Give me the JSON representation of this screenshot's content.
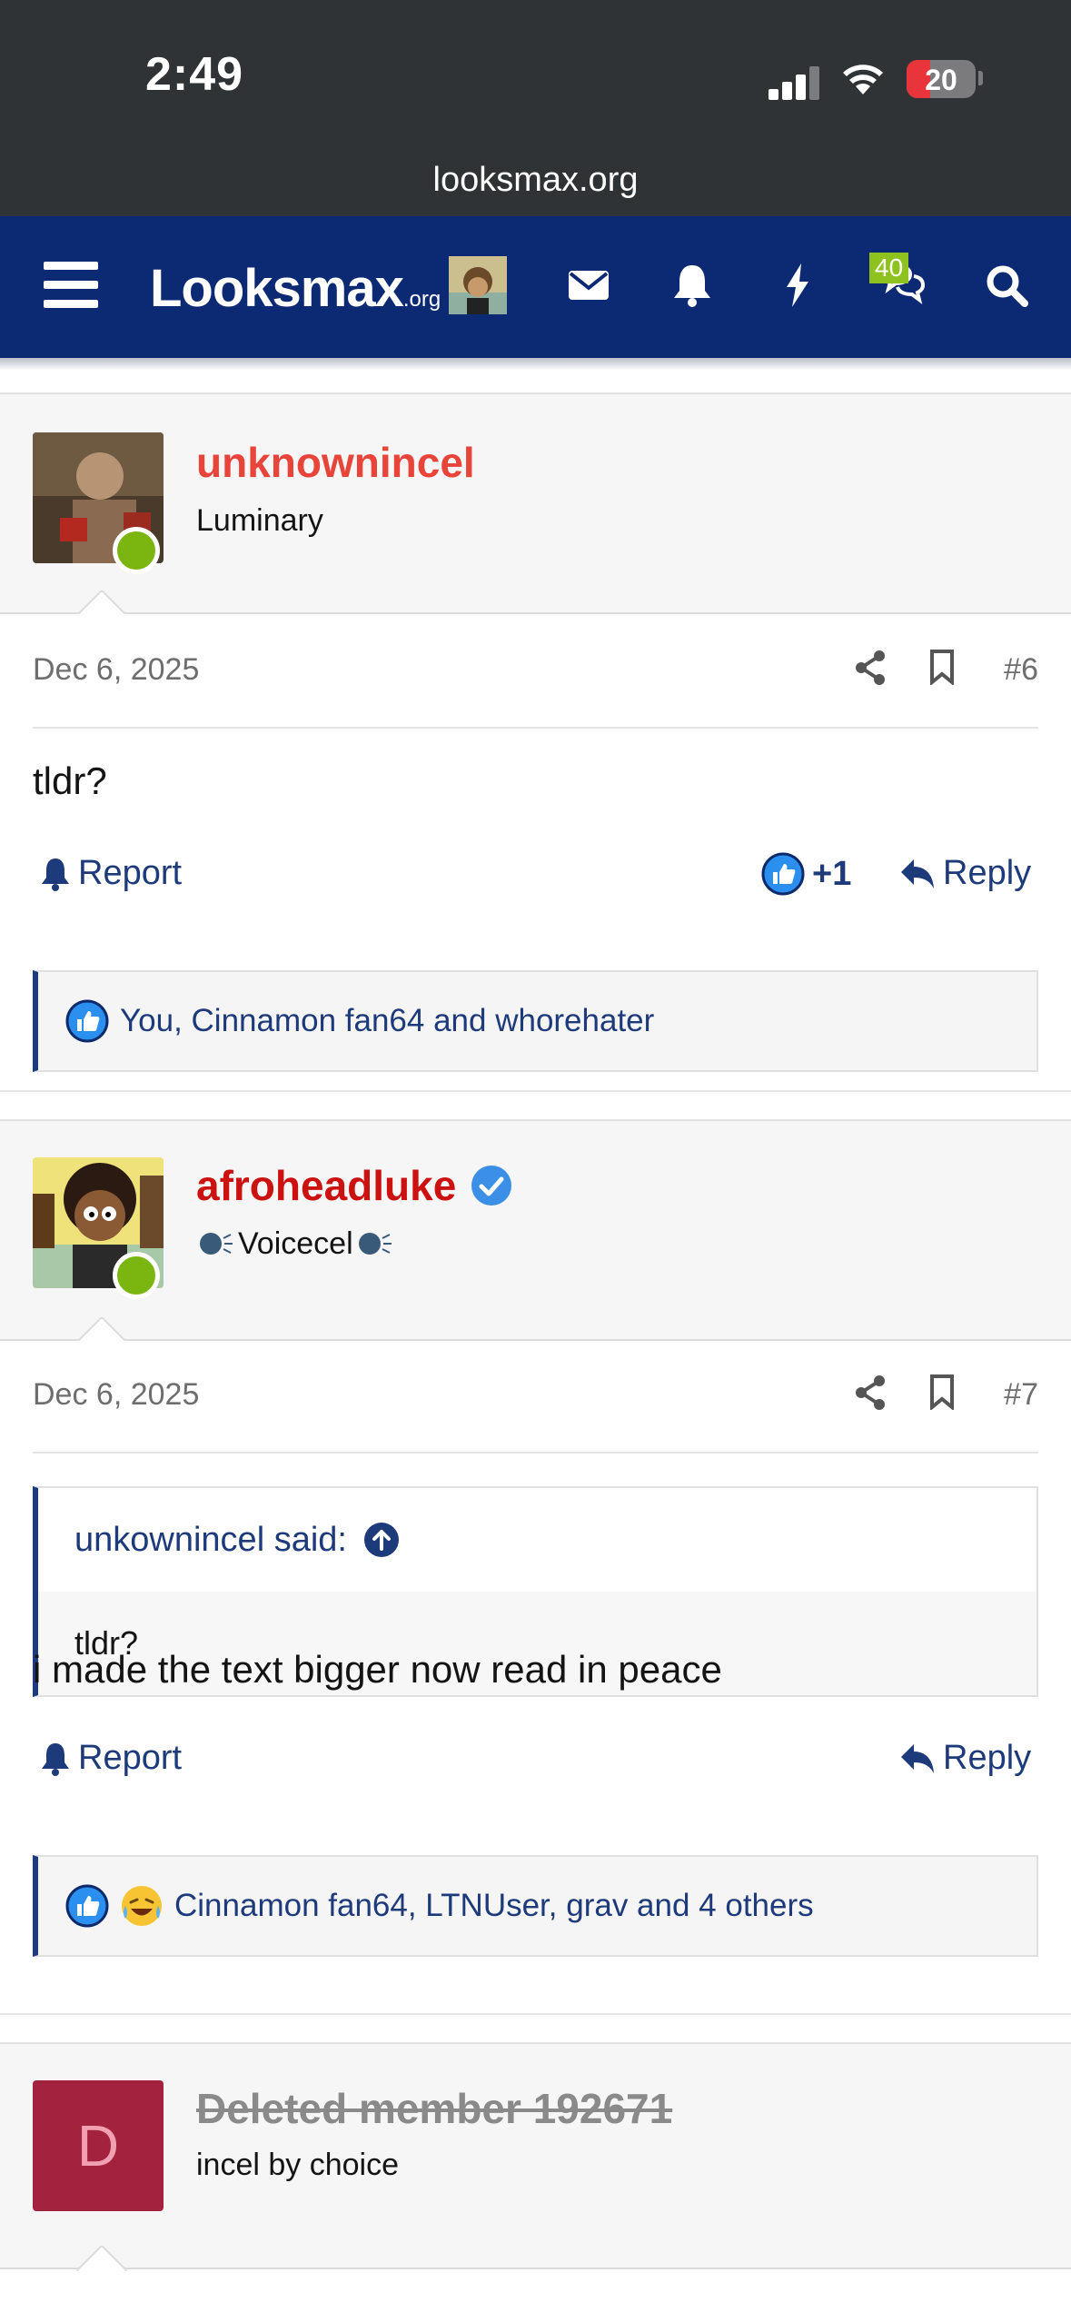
{
  "status_bar": {
    "time": "2:49",
    "battery": "20",
    "url": "looksmax.org"
  },
  "nav": {
    "logo_main": "Looksmax",
    "logo_suffix": ".org",
    "badge_count": "40"
  },
  "posts": [
    {
      "username": "unknownincel",
      "user_title": "Luminary",
      "date": "Dec 6, 2025",
      "number": "#6",
      "message": "tldr?",
      "report_label": "Report",
      "reply_label": "Reply",
      "reaction_score": "+1",
      "reactions_text": "You, Cinnamon fan64 and whorehater",
      "username_color": "#e8443a"
    },
    {
      "username": "afroheadluke",
      "user_title": "Voicecel",
      "date": "Dec 6, 2025",
      "number": "#7",
      "quote_author": "unkownincel said:",
      "quote_text": "tldr?",
      "message": "i made the text bigger now read in peace",
      "report_label": "Report",
      "reply_label": "Reply",
      "reactions_text": "Cinnamon fan64, LTNUser, grav and 4 others",
      "username_color": "#cc1111"
    },
    {
      "avatar_letter": "D",
      "username": "Deleted member 192671",
      "user_title": "incel by choice",
      "avatar_color": "#a3233f"
    }
  ],
  "colors": {
    "nav_bg": "#0c2a73",
    "link": "#1d3a7a",
    "online": "#7bb50f"
  }
}
